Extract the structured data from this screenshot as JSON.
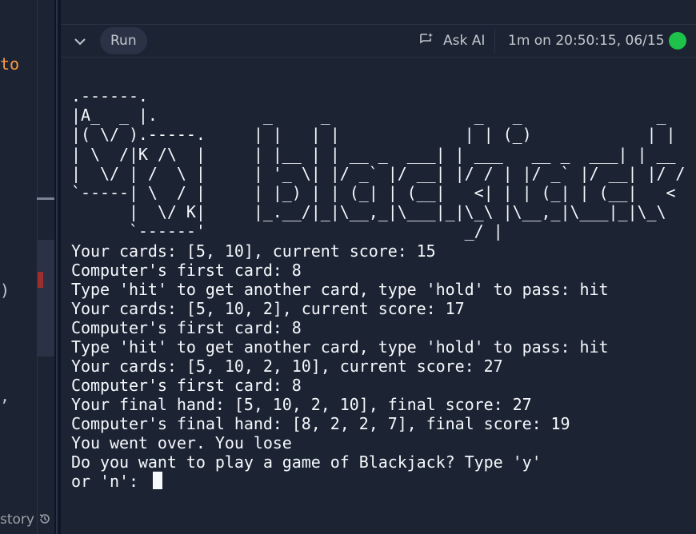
{
  "editor": {
    "fragments": [
      {
        "text": "to",
        "color": "#ff9940"
      },
      {
        "text": ")",
        "color": "#c2c8cc"
      },
      {
        "text": ",",
        "color": "#c2c8cc"
      }
    ],
    "history_label": "story",
    "history_icon": "history-icon"
  },
  "toolbar": {
    "collapse_icon": "chevron-down-icon",
    "run_label": "Run",
    "ask_ai_label": "Ask AI",
    "ask_ai_icon": "chat-sparkle-icon",
    "run_status": "1m on 20:50:15, 06/15",
    "status_color": "#1ec24a"
  },
  "terminal": {
    "ascii_art": ".------.\n|A_  _ |.           _     _               _   _              _\n|( \\/ ).-----.     | |   | |             | | (_)            | |\n| \\  /|K /\\  |     | |__ | | __ _  ___| | ___   __ _  ___| | __\n|  \\/ | /  \\ |     | '_ \\| |/ _` |/ __| |/ / | |/ _` |/ __| |/ /\n`-----| \\  / |     | |_) | | (_| | (__|   <| | | (_| | (__|   <\n      |  \\/ K|     |_.__/|_|\\__,_|\\___|_|\\_\\ |\\__,_|\\___|_|\\_\\\n      `------'                           _/ |\n                                        |__/",
    "lines": [
      "Your cards: [5, 10], current score: 15",
      "Computer's first card: 8",
      "Type 'hit' to get another card, type 'hold' to pass: hit",
      "Your cards: [5, 10, 2], current score: 17",
      "Computer's first card: 8",
      "Type 'hit' to get another card, type 'hold' to pass: hit",
      "Your cards: [5, 10, 2, 10], current score: 27",
      "Computer's first card: 8",
      "Your final hand: [5, 10, 2, 10], final score: 27",
      "Computer's final hand: [8, 2, 2, 7], final score: 19",
      "You went over. You lose",
      "Do you want to play a game of Blackjack? Type 'y'",
      "or 'n': "
    ]
  }
}
